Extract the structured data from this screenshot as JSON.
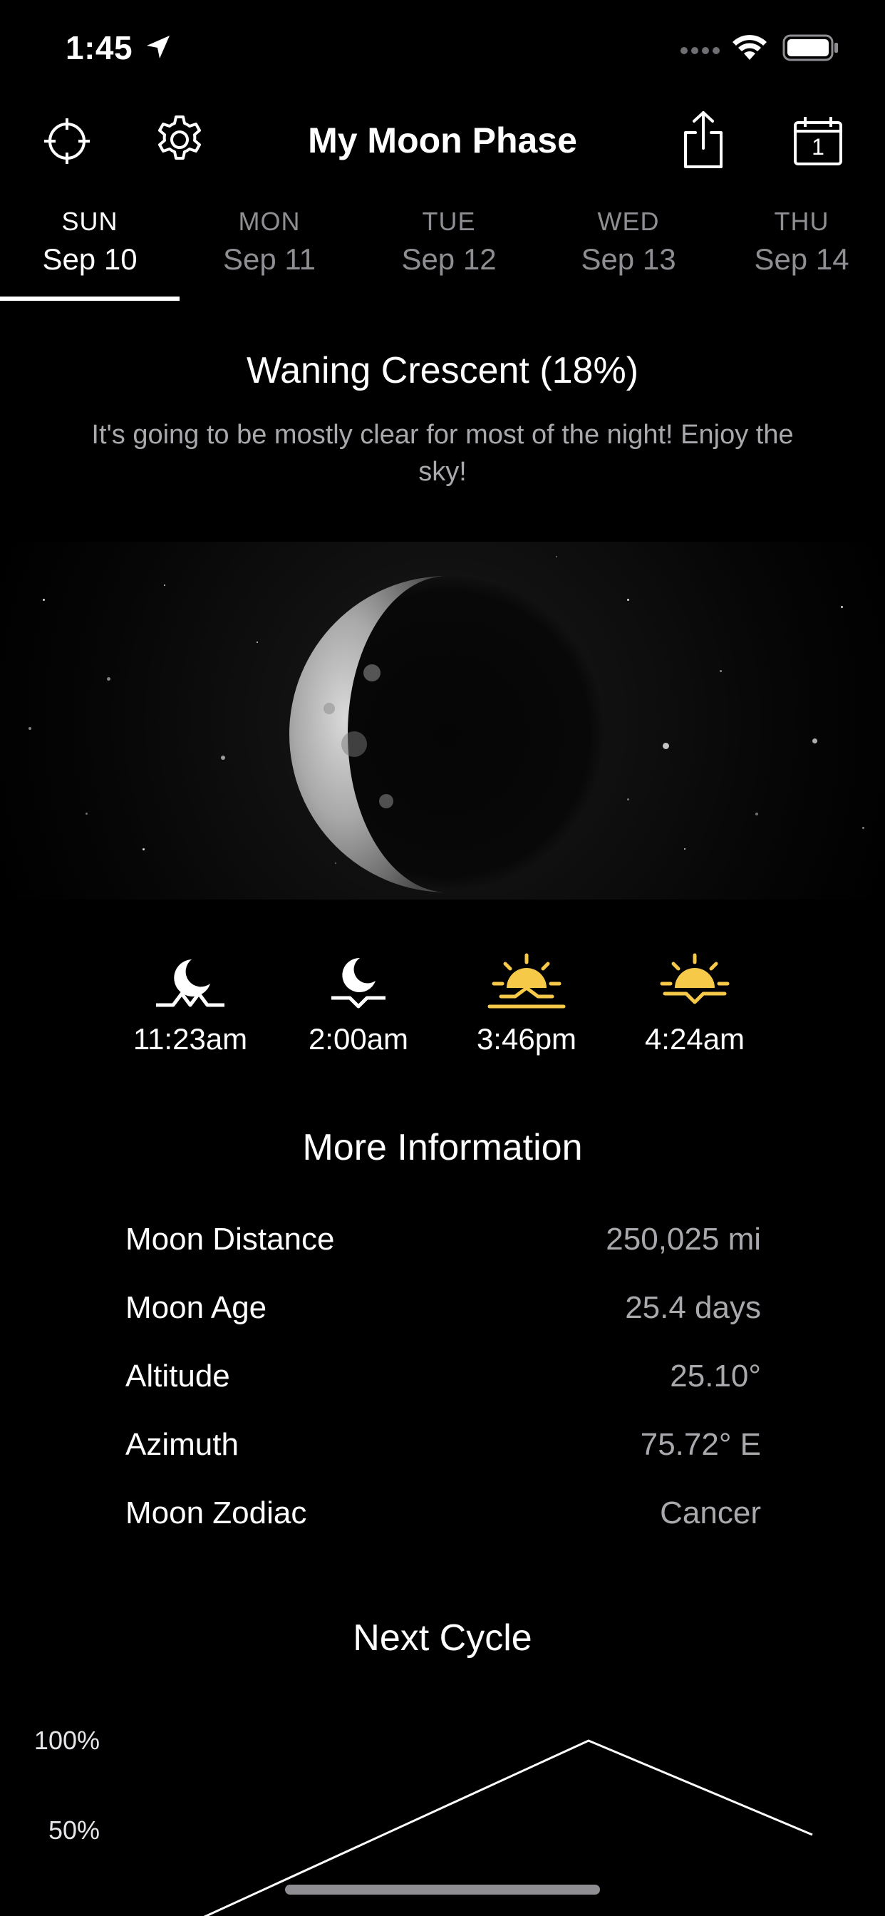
{
  "status_bar": {
    "time": "1:45"
  },
  "header": {
    "title": "My Moon Phase",
    "calendar_day": "1"
  },
  "tabs": [
    {
      "dow": "SUN",
      "date": "Sep 10",
      "active": true
    },
    {
      "dow": "MON",
      "date": "Sep 11",
      "active": false
    },
    {
      "dow": "TUE",
      "date": "Sep 12",
      "active": false
    },
    {
      "dow": "WED",
      "date": "Sep 13",
      "active": false
    },
    {
      "dow": "THU",
      "date": "Sep 14",
      "active": false
    }
  ],
  "phase": {
    "title": "Waning Crescent (18%)",
    "description": "It's going to be mostly clear for most of the night! Enjoy the sky!"
  },
  "rise_set": [
    {
      "icon": "moonrise-icon",
      "time": "11:23am",
      "color": "#ffffff"
    },
    {
      "icon": "moonset-icon",
      "time": "2:00am",
      "color": "#ffffff"
    },
    {
      "icon": "sunset-icon",
      "time": "3:46pm",
      "color": "#f7c948"
    },
    {
      "icon": "sunrise-icon",
      "time": "4:24am",
      "color": "#f7c948"
    }
  ],
  "more_info": {
    "title": "More Information",
    "rows": [
      {
        "label": "Moon Distance",
        "value": "250,025 mi"
      },
      {
        "label": "Moon Age",
        "value": "25.4 days"
      },
      {
        "label": "Altitude",
        "value": "25.10°"
      },
      {
        "label": "Azimuth",
        "value": "75.72° E"
      },
      {
        "label": "Moon Zodiac",
        "value": "Cancer"
      }
    ]
  },
  "next_cycle": {
    "title": "Next Cycle"
  },
  "chart_data": {
    "type": "line",
    "title": "Next Cycle",
    "y_ticks": [
      "100%",
      "50%"
    ],
    "ylim": [
      0,
      100
    ],
    "series": [
      {
        "values": [
          0,
          100,
          50
        ]
      }
    ]
  },
  "colors": {
    "accent": "#f7c948",
    "secondary_text": "#8e8e93"
  }
}
